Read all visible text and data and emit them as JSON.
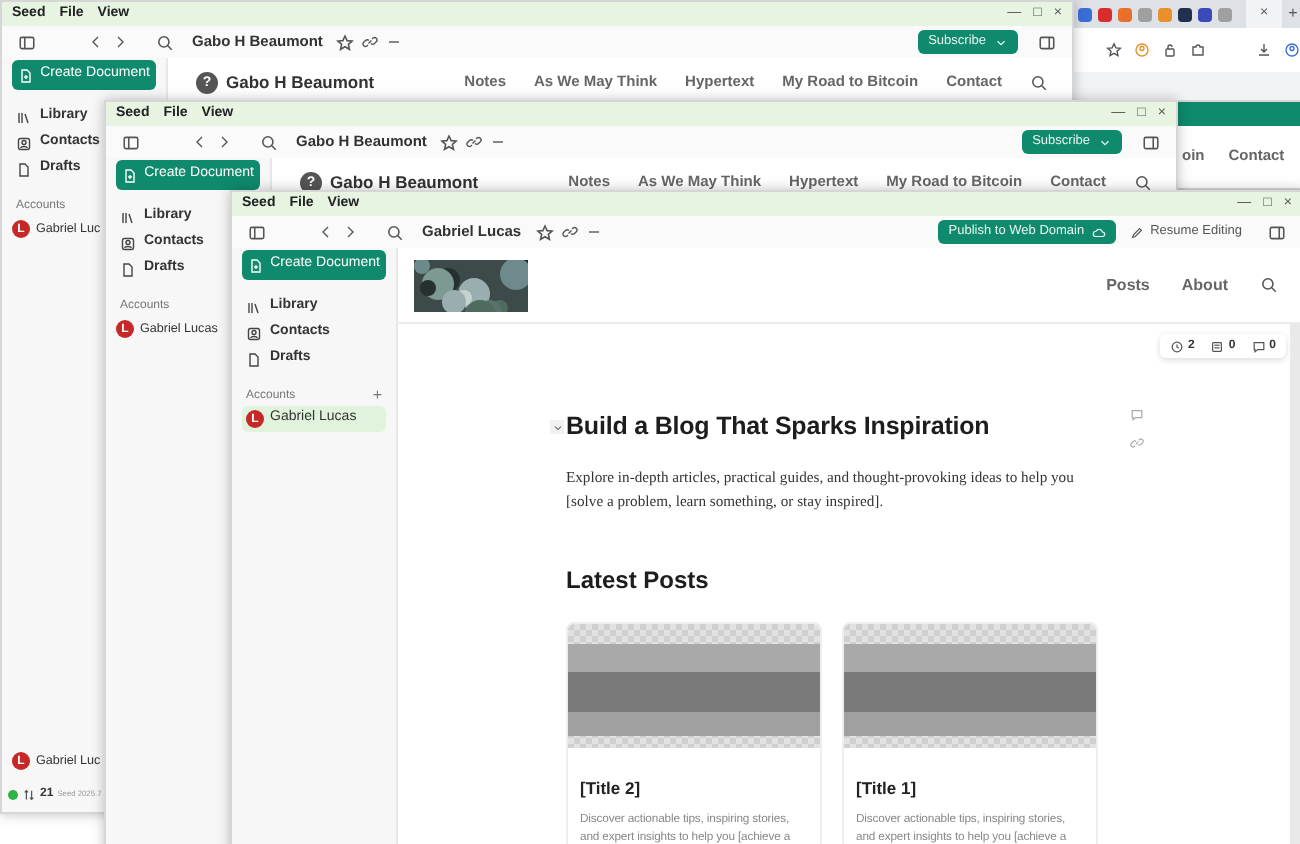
{
  "browser": {
    "favicons": [
      {
        "color": "#3b6fd8"
      },
      {
        "color": "#d92d2d"
      },
      {
        "color": "#e8702a"
      },
      {
        "color": "#a0a0a0"
      },
      {
        "color": "#e8902a"
      },
      {
        "color": "#22304f"
      },
      {
        "color": "#3a4bb8"
      },
      {
        "color": "#a0a0a0"
      }
    ],
    "close": "×",
    "new_tab": "+"
  },
  "windows": [
    {
      "kind": "site",
      "menu": [
        "Seed",
        "File",
        "View"
      ],
      "controls": [
        "—",
        "□",
        "×"
      ],
      "toolbar_title": "Gabo H Beaumont",
      "action": {
        "label": "Subscribe",
        "kind": "dropdown"
      },
      "sidebar": {
        "create": "Create Document",
        "items": [
          {
            "label": "Library",
            "kind": "library"
          },
          {
            "label": "Contacts",
            "kind": "contacts"
          },
          {
            "label": "Drafts",
            "kind": "drafts"
          }
        ],
        "accounts_label": "Accounts",
        "accounts": [
          {
            "avatar": "L",
            "name": "Gabriel Luc",
            "selected": false
          }
        ],
        "footer": {
          "avatar": "L",
          "name": "Gabriel Luc",
          "online": true,
          "count": "21",
          "version": "Seed 2025.7"
        }
      },
      "site": {
        "avatar": "?",
        "name": "Gabo H Beaumont",
        "nav": [
          "Notes",
          "As We May Think",
          "Hypertext",
          "My Road to Bitcoin",
          "Contact"
        ]
      }
    },
    {
      "kind": "site",
      "menu": [
        "Seed",
        "File",
        "View"
      ],
      "controls": [
        "—",
        "□",
        "×"
      ],
      "toolbar_title": "Gabo H Beaumont",
      "action": {
        "label": "Subscribe",
        "kind": "dropdown"
      },
      "sidebar": {
        "create": "Create Document",
        "items": [
          {
            "label": "Library",
            "kind": "library"
          },
          {
            "label": "Contacts",
            "kind": "contacts"
          },
          {
            "label": "Drafts",
            "kind": "drafts"
          }
        ],
        "accounts_label": "Accounts",
        "accounts": [
          {
            "avatar": "L",
            "name": "Gabriel Lucas",
            "selected": false
          }
        ]
      },
      "site": {
        "avatar": "?",
        "name": "Gabo H Beaumont",
        "nav": [
          "Notes",
          "As We May Think",
          "Hypertext",
          "My Road to Bitcoin",
          "Contact"
        ]
      }
    },
    {
      "kind": "partial",
      "nav": [
        "oin",
        "Contact"
      ]
    },
    {
      "kind": "document",
      "menu": [
        "Seed",
        "File",
        "View"
      ],
      "controls": [
        "—",
        "□",
        "×"
      ],
      "toolbar_title": "Gabriel Lucas",
      "action": {
        "label": "Publish to Web Domain",
        "kind": "publish"
      },
      "secondary_action": "Resume Editing",
      "sidebar": {
        "create": "Create Document",
        "items": [
          {
            "label": "Library",
            "kind": "library"
          },
          {
            "label": "Contacts",
            "kind": "contacts"
          },
          {
            "label": "Drafts",
            "kind": "drafts"
          }
        ],
        "accounts_label": "Accounts",
        "accounts_add": "+",
        "accounts": [
          {
            "avatar": "L",
            "name": "Gabriel Lucas",
            "selected": true
          }
        ]
      },
      "site": {
        "header_image": {
          "kind": "picture"
        },
        "nav": [
          "Posts",
          "About"
        ]
      },
      "stats": [
        {
          "kind": "versions",
          "value": "2"
        },
        {
          "kind": "citations",
          "value": "0"
        },
        {
          "kind": "comments",
          "value": "0"
        }
      ],
      "document": {
        "title": "Build a Blog That Sparks Inspiration",
        "paragraph": "Explore in-depth articles, practical guides, and thought-provoking ideas to help you [solve a problem, learn something, or stay inspired].",
        "section_title": "Latest Posts",
        "cards": [
          {
            "image": {
              "kind": "picture"
            },
            "title": "[Title 2]",
            "text": "Discover actionable tips, inspiring stories, and expert insights to help you [achieve a"
          },
          {
            "image": {
              "kind": "picture"
            },
            "title": "[Title 1]",
            "text": "Discover actionable tips, inspiring stories, and expert insights to help you [achieve a"
          }
        ]
      }
    }
  ]
}
